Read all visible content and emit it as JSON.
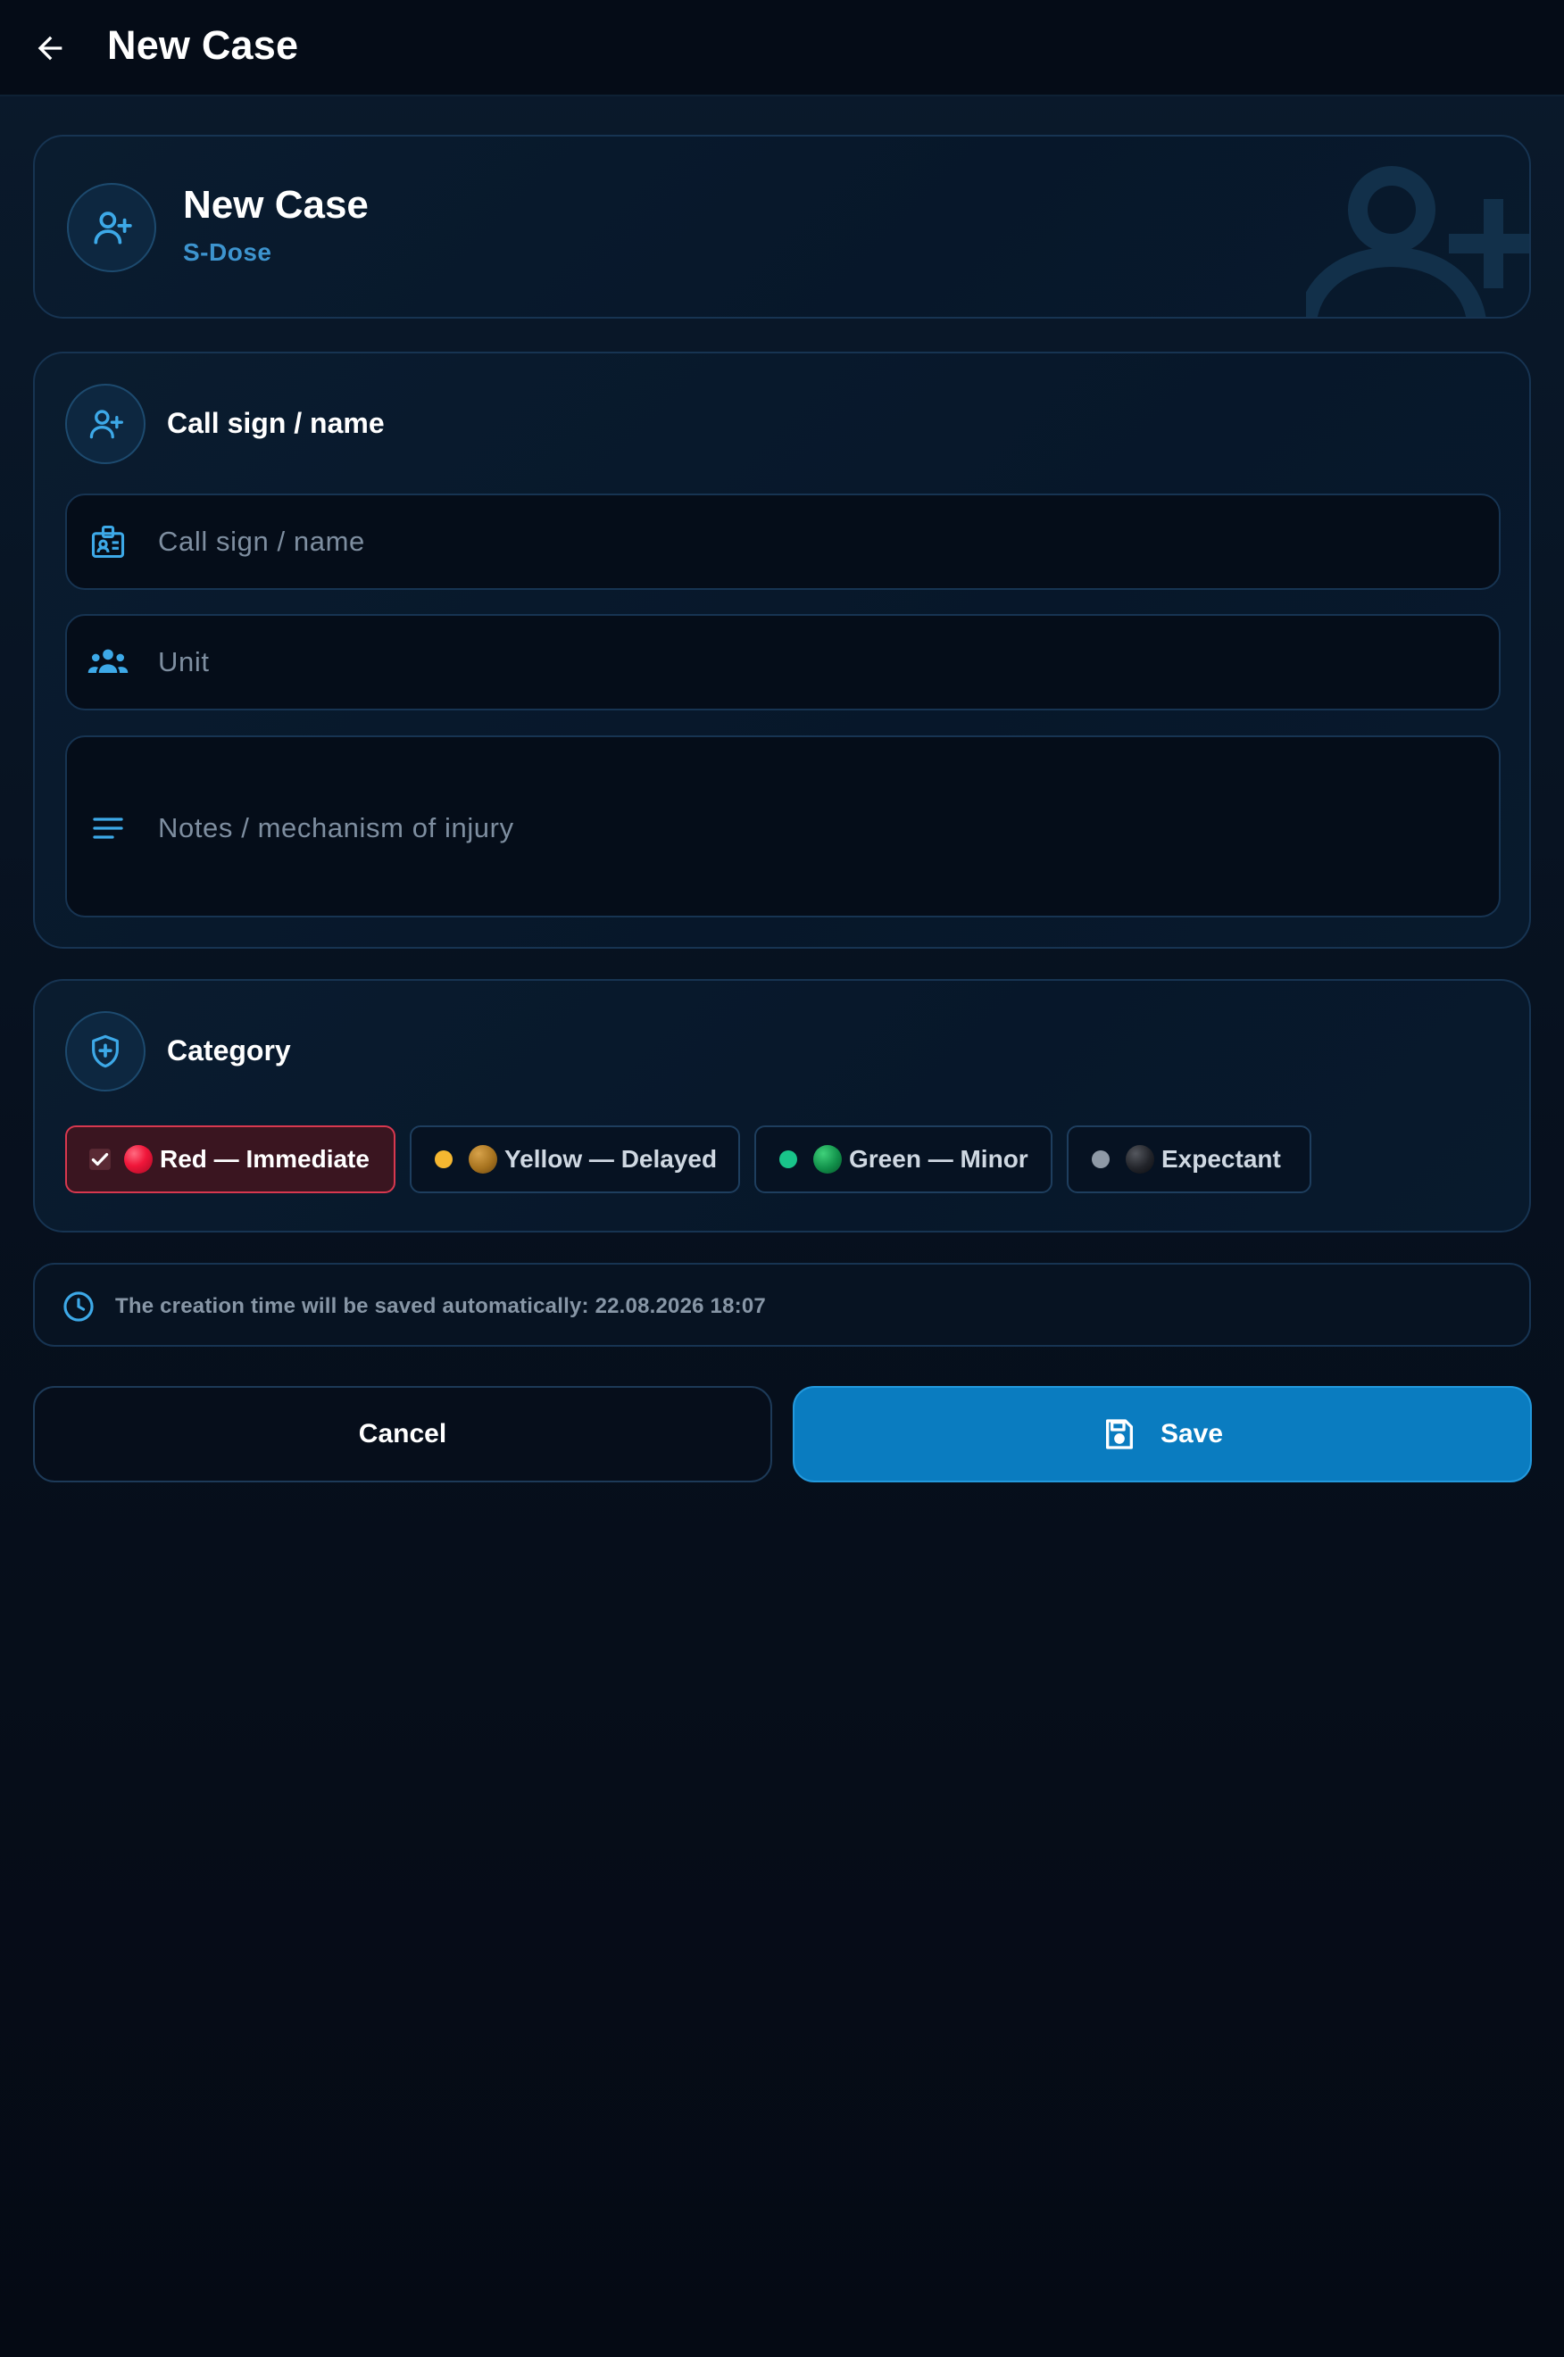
{
  "appbar": {
    "title": "New Case"
  },
  "header": {
    "title": "New Case",
    "subtitle": "S-Dose"
  },
  "identity": {
    "section_title": "Call sign / name",
    "callsign_placeholder": "Call sign / name",
    "unit_placeholder": "Unit",
    "notes_placeholder": "Notes / mechanism of injury"
  },
  "category": {
    "section_title": "Category",
    "options": [
      {
        "label": "Red — Immediate",
        "selected": true,
        "color": "#e8223f"
      },
      {
        "label": "Yellow — Delayed",
        "selected": false,
        "color": "#f5b731"
      },
      {
        "label": "Green — Minor",
        "selected": false,
        "color": "#19c48a"
      },
      {
        "label": "Expectant",
        "selected": false,
        "color": "#8e99a6"
      }
    ]
  },
  "info": {
    "text": "The creation time will be saved automatically: 22.08.2026 18:07"
  },
  "actions": {
    "cancel_label": "Cancel",
    "save_label": "Save"
  },
  "colors": {
    "accent": "#0a7cc0",
    "icon": "#3da9e8",
    "danger": "#d8384f"
  }
}
